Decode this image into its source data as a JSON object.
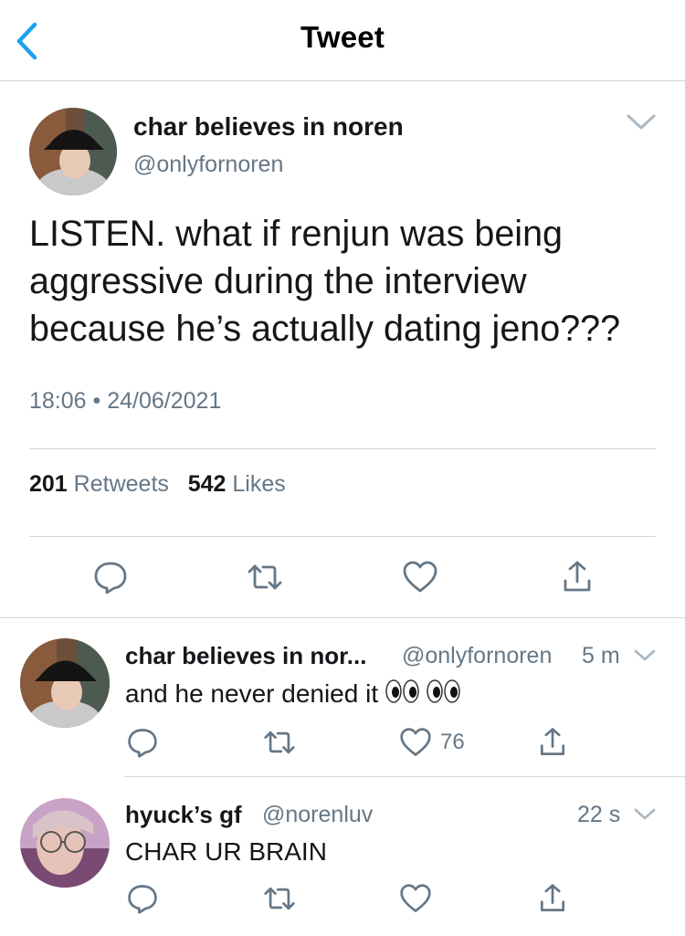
{
  "header": {
    "title": "Tweet",
    "back_icon": "chevron-left-icon"
  },
  "main_tweet": {
    "name": "char believes in noren",
    "handle": "@onlyfornoren",
    "text_lines": [
      "LISTEN. what if renjun was being",
      "aggressive during the interview",
      "because he’s actually dating jeno???"
    ],
    "time": "18:06",
    "separator": "•",
    "date": "24/06/2021",
    "retweets_count": "201",
    "retweets_label": "Retweets",
    "likes_count": "542",
    "likes_label": "Likes",
    "actions": [
      "reply-icon",
      "retweet-icon",
      "like-icon",
      "share-icon"
    ]
  },
  "replies": [
    {
      "name": "char believes in nor...",
      "handle": "@onlyfornoren",
      "time": "5 m",
      "text": "and he never denied it",
      "emoji": "eyes-emoji",
      "like_count": "76"
    },
    {
      "name": "hyuck’s gf",
      "handle": "@norenluv",
      "time": "22 s",
      "text": "CHAR UR BRAIN",
      "like_count": ""
    }
  ],
  "colors": {
    "accent": "#1da1f2",
    "text": "#14171a",
    "muted": "#657786",
    "divider": "#d3d6db"
  }
}
